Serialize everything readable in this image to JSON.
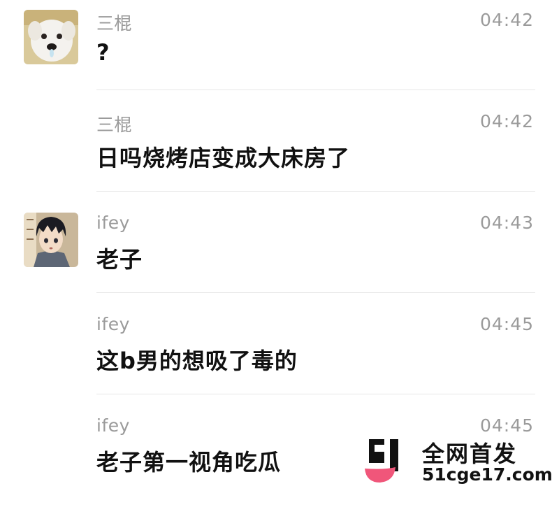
{
  "messages": [
    {
      "sender": "三棍",
      "time": "04:42",
      "text": "?",
      "avatar": "puppy-avatar"
    },
    {
      "sender": "三棍",
      "time": "04:42",
      "text": "日吗烧烤店变成大床房了"
    },
    {
      "sender": "ifey",
      "time": "04:43",
      "text": "老子",
      "avatar": "anime-boy-avatar"
    },
    {
      "sender": "ifey",
      "time": "04:45",
      "text": "这b男的想吸了毒的"
    },
    {
      "sender": "ifey",
      "time": "04:45",
      "text": "老子第一视角吃瓜"
    }
  ],
  "watermark": {
    "title": "全网首发",
    "url": "51cge17.com",
    "colors": {
      "mark": "#111111",
      "accent": "#f0567a"
    }
  },
  "colors": {
    "meta_text": "#9a9a9a",
    "message_text": "#111111",
    "divider": "#e6e6e6",
    "background": "#ffffff"
  }
}
